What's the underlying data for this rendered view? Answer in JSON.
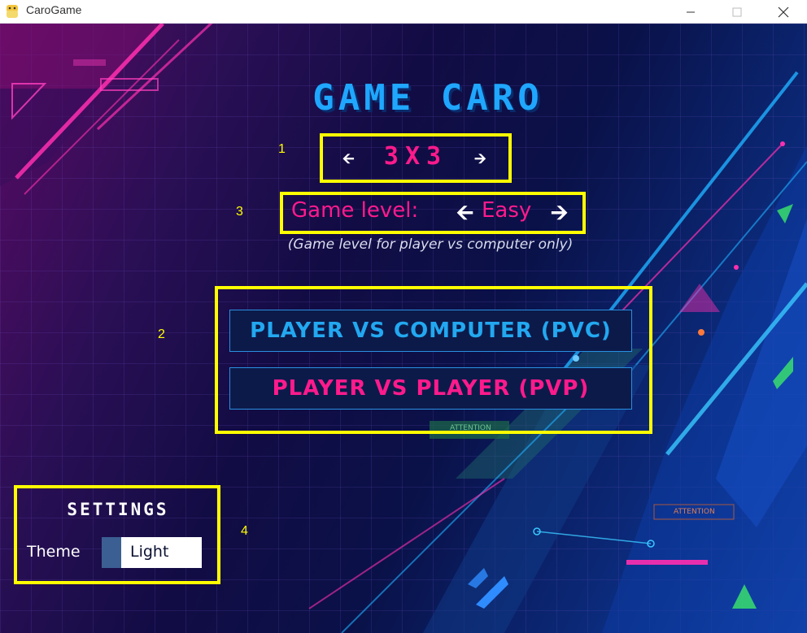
{
  "window": {
    "title": "CaroGame",
    "icon": "python-icon",
    "controls": {
      "minimize": "minimize-icon",
      "maximize": "maximize-icon",
      "close": "close-icon"
    }
  },
  "game": {
    "title": "GAME CARO",
    "board_size": "3X3",
    "level_label": "Game level:",
    "level_value": "Easy",
    "level_note": "(Game level for player vs computer only)",
    "modes": {
      "pvc": "PLAYER VS COMPUTER (PVC)",
      "pvp": "PLAYER VS PLAYER (PVP)"
    }
  },
  "settings": {
    "title": "SETTINGS",
    "theme_label": "Theme",
    "theme_value": "Light"
  },
  "annotations": [
    "1",
    "2",
    "3",
    "4"
  ],
  "background_text": {
    "attention_1": "ATTENTION",
    "attention_2": "ATTENTION"
  },
  "colors": {
    "title": "#1fa7ff",
    "accent_pink": "#ff1a8c",
    "accent_blue": "#22a8f0",
    "annotation_yellow": "#ffff00"
  }
}
